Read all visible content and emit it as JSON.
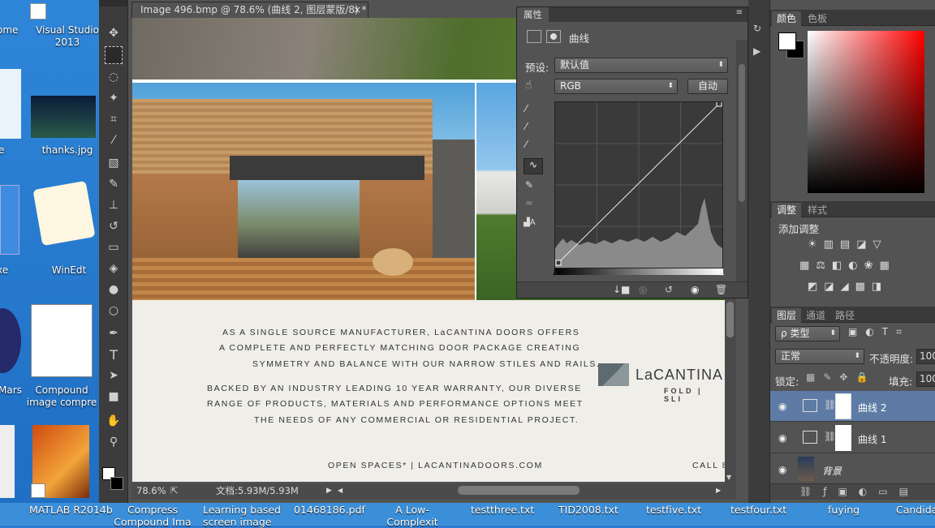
{
  "desktop": {
    "items": [
      {
        "label": "ome"
      },
      {
        "label": "Visual Studio 2013"
      },
      {
        "label": "thanks.jpg"
      },
      {
        "label": "e"
      },
      {
        "label": "xe"
      },
      {
        "label": "WinEdt"
      },
      {
        "label": "Mars"
      },
      {
        "label": "Compound image compre"
      }
    ]
  },
  "taskbar": {
    "items": [
      "MATLAB R2014b",
      "Compress Compound Ima",
      "Learning based screen image",
      "01468186.pdf",
      "A Low-Complexit",
      "testthree.txt",
      "TID2008.txt",
      "testfive.txt",
      "testfour.txt",
      "fuying",
      "Candida"
    ]
  },
  "document": {
    "tab_title": "Image 496.bmp @ 78.6% (曲线 2, 图层蒙版/8) *",
    "close": "×",
    "ad": {
      "p1": [
        "AS A SINGLE SOURCE MANUFACTURER, LaCANTINA DOORS OFFERS",
        "A COMPLETE AND PERFECTLY MATCHING DOOR PACKAGE CREATING",
        "SYMMETRY AND BALANCE WITH OUR NARROW STILES AND RAILS."
      ],
      "p2": [
        "BACKED BY AN INDUSTRY LEADING 10 YEAR WARRANTY, OUR DIVERSE",
        "RANGE OF PRODUCTS, MATERIALS AND PERFORMANCE OPTIONS MEET",
        "THE NEEDS OF ANY COMMERCIAL OR RESIDENTIAL PROJECT."
      ],
      "footer": "OPEN SPACES*  |  LACANTINADOORS.COM",
      "call": "CALL 8",
      "logo": "LaCANTINA",
      "logo_sub": "FOLD | SLI"
    }
  },
  "status": {
    "zoom": "78.6%",
    "doc": "文档:5.93M/5.93M"
  },
  "properties": {
    "tab": "属性",
    "title": "曲线",
    "preset_label": "预设:",
    "preset_value": "默认值",
    "channel": "RGB",
    "auto": "自动"
  },
  "color_panel": {
    "tabs": [
      "颜色",
      "色板"
    ],
    "fg": "#ffffff",
    "bg": "#000000",
    "hue": "#ff0000"
  },
  "adjust_panel": {
    "tabs": [
      "调整",
      "样式"
    ],
    "add_label": "添加调整"
  },
  "layers_panel": {
    "tabs": [
      "图层",
      "通道",
      "路径"
    ],
    "filter": "ρ 类型",
    "blend": "正常",
    "opacity_label": "不透明度:",
    "opacity": "100",
    "lock_label": "锁定:",
    "fill_label": "填充:",
    "fill": "100",
    "layers": [
      {
        "name": "曲线 2",
        "selected": true
      },
      {
        "name": "曲线 1",
        "selected": false
      },
      {
        "name": "背景",
        "selected": false
      }
    ]
  }
}
